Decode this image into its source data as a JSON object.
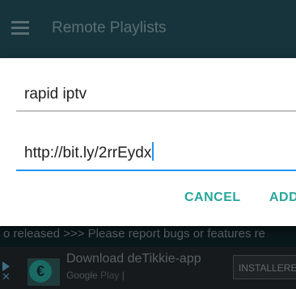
{
  "appbar": {
    "title": "Remote Playlists",
    "menu_icon": "hamburger-menu-icon"
  },
  "dialog": {
    "name_field_value": "rapid iptv",
    "url_field_value": "http://bit.ly/2rrEydx",
    "cancel_label": "CANCEL",
    "add_label": "ADD",
    "accent_color": "#26a69a",
    "focus_color": "#2196f3"
  },
  "background": {
    "ticker_text": "o released >>> Please report bugs or features re"
  },
  "ad": {
    "title": "Download deTikkie-app",
    "store_label": "Google",
    "store_label_light": "Play",
    "separator": "|",
    "install_label": "INSTALLERE",
    "logo_glyph": "€"
  }
}
